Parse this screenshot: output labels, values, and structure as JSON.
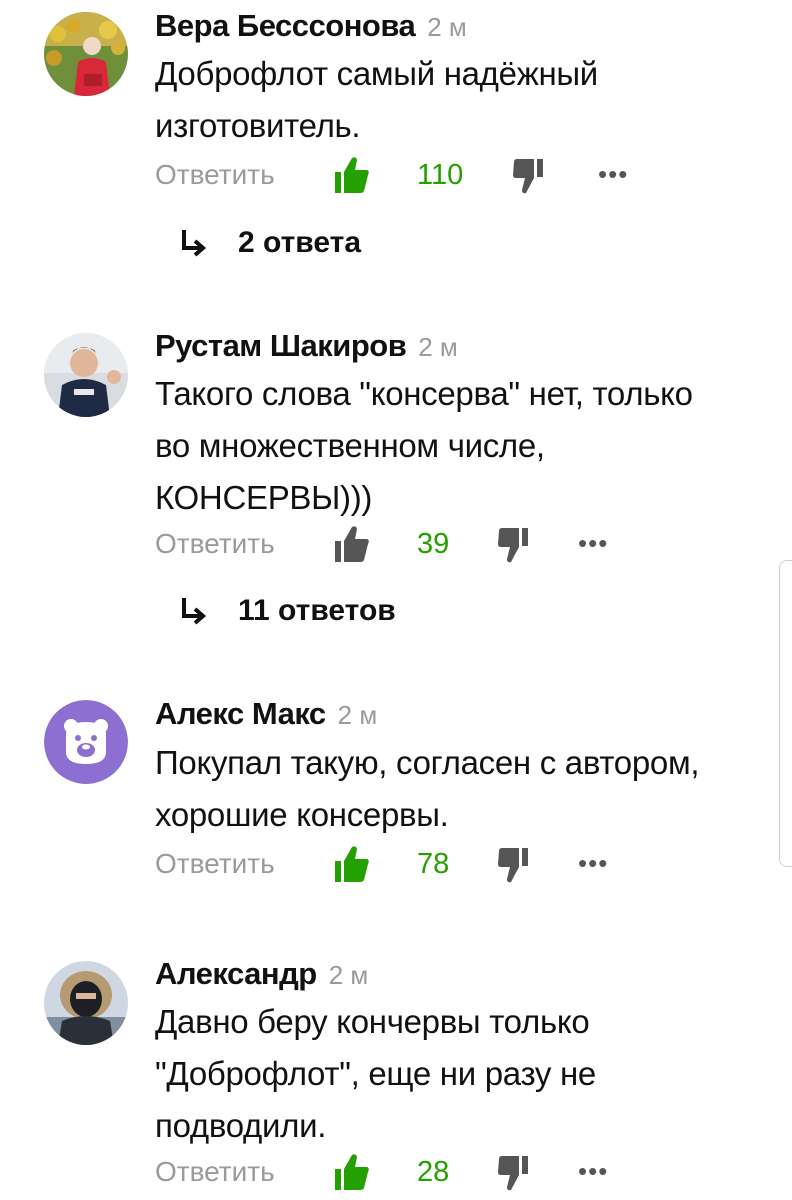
{
  "comments": [
    {
      "author": "Вера Бесссонова",
      "time": "2 м",
      "text_lines": [
        "Доброфлот самый надёжный",
        "изготовитель."
      ],
      "reply_label": "Ответить",
      "likes": "110",
      "replies": "2 ответа"
    },
    {
      "author": "Рустам Шакиров",
      "time": "2 м",
      "text_lines": [
        "Такого слова \"консерва\" нет, только",
        "во множественном числе,",
        "КОНСЕРВЫ)))"
      ],
      "reply_label": "Ответить",
      "likes": "39",
      "replies": "11 ответов"
    },
    {
      "author": "Алекс Макс",
      "time": "2 м",
      "text_lines": [
        "Покупал такую, согласен с автором,",
        "хорошие консервы."
      ],
      "reply_label": "Ответить",
      "likes": "78",
      "replies": ""
    },
    {
      "author": "Александр",
      "time": "2 м",
      "text_lines": [
        "Давно беру кончервы только",
        "\"Доброфлот\", еще ни разу не",
        "подводили."
      ],
      "reply_label": "Ответить",
      "likes": "28",
      "replies": ""
    }
  ],
  "icons": {
    "like": "thumbs-up-icon",
    "dislike": "thumbs-down-icon",
    "more": "more-dots-icon",
    "replies_arrow": "reply-arrow-icon"
  },
  "colors": {
    "like_count": "#24a000",
    "secondary_text": "#9a9a9a",
    "bear_avatar_bg": "#8c6fd0"
  }
}
